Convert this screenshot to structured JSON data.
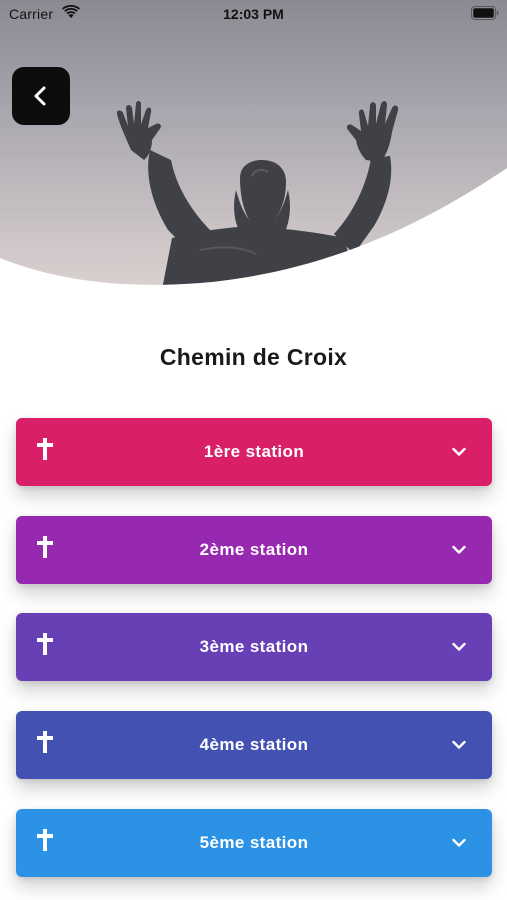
{
  "status_bar": {
    "carrier": "Carrier",
    "time": "12:03 PM"
  },
  "header": {
    "back_icon": "chevron-left-icon",
    "image": "statue-of-christ-with-raised-arms"
  },
  "title": "Chemin de Croix",
  "stations": [
    {
      "label": "1ère station",
      "color": "#D81F68",
      "icon": "cross-icon"
    },
    {
      "label": "2ème station",
      "color": "#9729B1",
      "icon": "cross-icon"
    },
    {
      "label": "3ème station",
      "color": "#6840B6",
      "icon": "cross-icon"
    },
    {
      "label": "4ème station",
      "color": "#4352B2",
      "icon": "cross-icon"
    },
    {
      "label": "5ème station",
      "color": "#2B92E6",
      "icon": "cross-icon"
    }
  ]
}
